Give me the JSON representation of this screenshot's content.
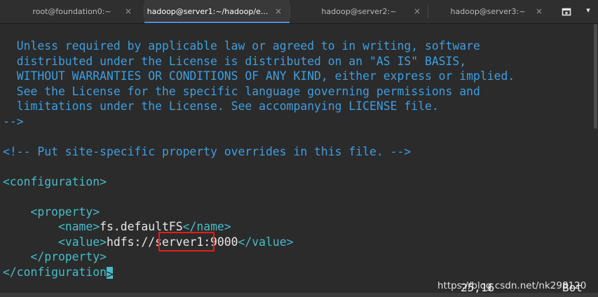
{
  "tabs": [
    {
      "label": "root@foundation0:~",
      "close": "×"
    },
    {
      "label": "hadoop@server1:~/hadoop/e...",
      "close": "×"
    },
    {
      "label": "hadoop@server2:~",
      "close": "×"
    },
    {
      "label": "hadoop@server3:~",
      "close": "×"
    }
  ],
  "tabbar": {
    "new_tab_icon": "⊞",
    "menu_icon": "▾"
  },
  "editor": {
    "license_lines": [
      "  Unless required by applicable law or agreed to in writing, software",
      "  distributed under the License is distributed on an \"AS IS\" BASIS,",
      "  WITHOUT WARRANTIES OR CONDITIONS OF ANY KIND, either express or implied.",
      "  See the License for the specific language governing permissions and",
      "  limitations under the License. See accompanying LICENSE file."
    ],
    "comment_close": "-->",
    "site_comment": "<!-- Put site-specific property overrides in this file. -->",
    "config_open": "<configuration>",
    "property_open": "    <property>",
    "name_indent": "        ",
    "name_open": "<name>",
    "name_value": "fs.defaultFS",
    "name_close": "</name>",
    "value_indent": "        ",
    "value_open": "<value>",
    "value_prefix": "hdfs://",
    "value_host": "server1",
    "value_port": ":9000",
    "value_close": "</value>",
    "property_close": "    </property>",
    "config_close": "</configuration",
    "config_close_tail": ">"
  },
  "status": {
    "position": "25,16",
    "scroll": "Bot"
  },
  "watermark": "https://blog.csdn.net/nk298120",
  "colors": {
    "comment": "#3e9ee0",
    "tag": "#47bcc8",
    "highlight": "#e01e1e",
    "active_tab_underline": "#4a90d9"
  }
}
